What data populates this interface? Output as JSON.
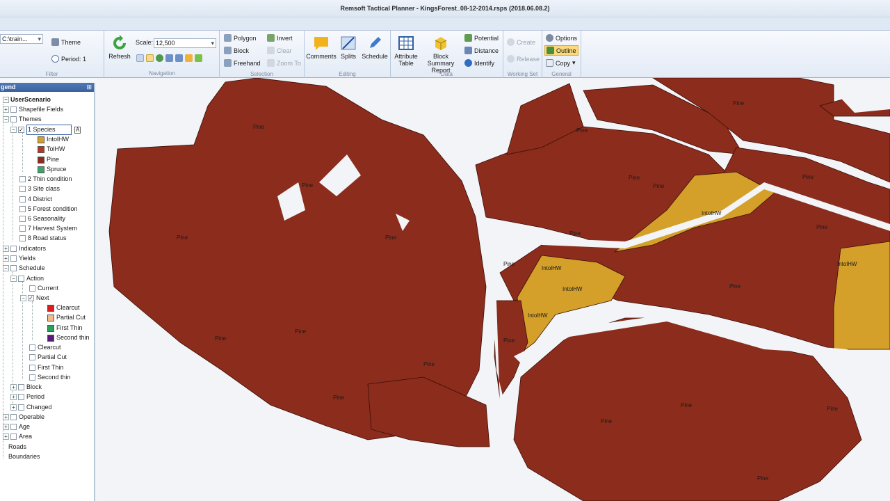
{
  "window": {
    "title": "Remsoft Tactical Planner - KingsForest_08-12-2014.rsps (2018.06.08.2)"
  },
  "colors": {
    "pine": "#8b2c1c",
    "intolhw": "#d4a02a",
    "tolhw": "#b33a22",
    "spruce": "#3da36a",
    "clearcut": "#e01b1b",
    "partial_cut": "#f4b98a",
    "first_thin": "#2ba05a",
    "second_thin": "#5a1a7a",
    "accent": "#3a62a0"
  },
  "ribbon": {
    "filter": {
      "combo_value": "C:\\train...",
      "theme_label": "Theme",
      "period_label": "Period: 1",
      "group_label": "Filter"
    },
    "navigation": {
      "refresh_label": "Refresh",
      "scale_label": "Scale:",
      "scale_value": "12,500",
      "group_label": "Navigation"
    },
    "selection": {
      "polygon_label": "Polygon",
      "block_label": "Block",
      "freehand_label": "Freehand",
      "invert_label": "Invert",
      "clear_label": "Clear",
      "zoom_to_label": "Zoom To",
      "group_label": "Selection"
    },
    "editing": {
      "comments_label": "Comments",
      "splits_label": "Splits",
      "schedule_label": "Schedule",
      "group_label": "Editing"
    },
    "data": {
      "attribute_table_label_1": "Attribute",
      "attribute_table_label_2": "Table",
      "block_summary_label_1": "Block Summary",
      "block_summary_label_2": "Report",
      "potential_label": "Potential",
      "distance_label": "Distance",
      "identify_label": "Identify",
      "group_label": "Data"
    },
    "working_set": {
      "create_label": "Create",
      "release_label": "Release",
      "group_label": "Working Set"
    },
    "general": {
      "options_label": "Options",
      "outline_label": "Outline",
      "copy_label": "Copy",
      "group_label": "General"
    }
  },
  "legend": {
    "title": "gend",
    "items": [
      {
        "label": "UserScenario"
      },
      {
        "label": "Shapefile Fields"
      },
      {
        "label": "Themes"
      },
      {
        "label": "1 Species"
      },
      {
        "label": "IntolHW"
      },
      {
        "label": "TolHW"
      },
      {
        "label": "Pine"
      },
      {
        "label": "Spruce"
      },
      {
        "label": "2 Thin condition"
      },
      {
        "label": "3 Site class"
      },
      {
        "label": "4 District"
      },
      {
        "label": "5 Forest condition"
      },
      {
        "label": "6 Seasonality"
      },
      {
        "label": "7 Harvest System"
      },
      {
        "label": "8 Road status"
      },
      {
        "label": "Indicators"
      },
      {
        "label": "Yields"
      },
      {
        "label": "Schedule"
      },
      {
        "label": "Action"
      },
      {
        "label": "Current"
      },
      {
        "label": "Next"
      },
      {
        "label": "Clearcut"
      },
      {
        "label": "Partial Cut"
      },
      {
        "label": "First Thin"
      },
      {
        "label": "Second thin"
      },
      {
        "label": "Clearcut"
      },
      {
        "label": "Partial Cut"
      },
      {
        "label": "First Thin"
      },
      {
        "label": "Second thin"
      },
      {
        "label": "Block"
      },
      {
        "label": "Period"
      },
      {
        "label": "Changed"
      },
      {
        "label": "Operable"
      },
      {
        "label": "Age"
      },
      {
        "label": "Area"
      },
      {
        "label": "Roads"
      },
      {
        "label": "Boundaries"
      }
    ]
  },
  "map": {
    "labels": [
      "Pine",
      "IntolHW"
    ]
  }
}
